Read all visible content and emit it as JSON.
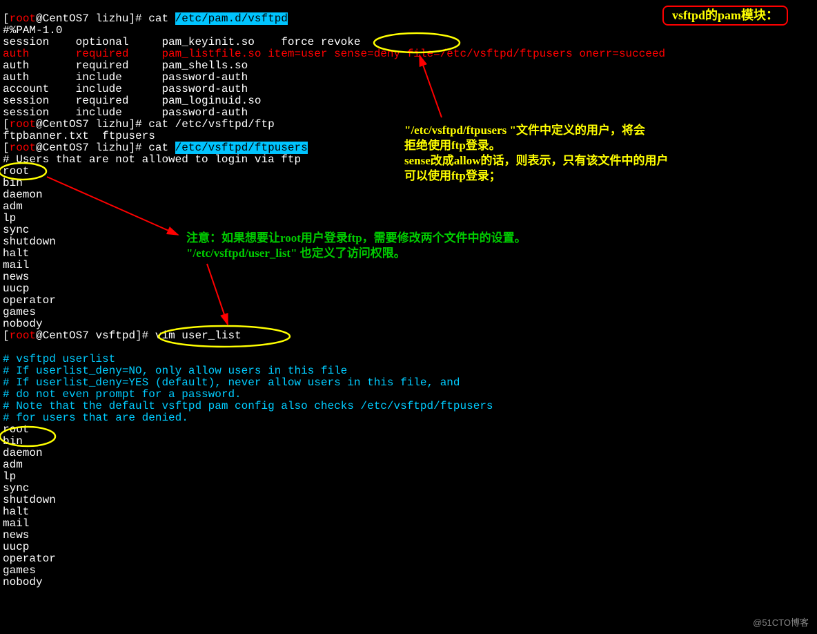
{
  "prompt": {
    "open": "[",
    "user": "root",
    "at": "@CentOS7 ",
    "dir1": "lizhu",
    "dir2": "vsftpd",
    "close": "]# "
  },
  "cmd": {
    "cat": "cat ",
    "vim": "vim "
  },
  "paths": {
    "pamd": "/etc/pam.d/vsftpd",
    "ftp": "/etc/vsftpd/ftp",
    "ftpusers": "/etc/vsftpd/ftpusers",
    "userlist": "user_list"
  },
  "pam": {
    "header": "#%PAM-1.0",
    "l1": "session    optional     pam_keyinit.so    force revoke",
    "l2a": "auth       required     pam_listfile.so item=user ",
    "l2b": "sense=deny",
    "l2c": " file=/etc/vsftpd/ftpusers onerr=succeed",
    "l3": "auth       required     pam_shells.so",
    "l4": "auth       include      password-auth",
    "l5": "account    include      password-auth",
    "l6": "session    required     pam_loginuid.so",
    "l7": "session    include      password-auth"
  },
  "ftpls": "ftpbanner.txt  ftpusers",
  "ftpusers_comment": "# Users that are not allowed to login via ftp",
  "users": [
    "root",
    "bin",
    "daemon",
    "adm",
    "lp",
    "sync",
    "shutdown",
    "halt",
    "mail",
    "news",
    "uucp",
    "operator",
    "games",
    "nobody"
  ],
  "userlist_comments": [
    "# vsftpd userlist",
    "# If userlist_deny=NO, only allow users in this file",
    "# If userlist_deny=YES (default), never allow users in this file, and",
    "# do not even prompt for a password.",
    "# Note that the default vsftpd pam config also checks /etc/vsftpd/ftpusers",
    "# for users that are denied."
  ],
  "annotations": {
    "title": "vsftpd的pam模块：",
    "note1_l1a": "\"/etc/vsftpd/ftpusers \"",
    "note1_l1b": "文件中定义的用户，将会",
    "note1_l2": "拒绝使用ftp登录。",
    "note1_l3a": "sense",
    "note1_l3b": "改成",
    "note1_l3c": "allow",
    "note1_l3d": "的话，则表示，只有该文件中的用户",
    "note1_l4": "可以使用ftp登录；",
    "note2_l1": "注意：如果想要让root用户登录ftp，需要修改两个文件中的设置。",
    "note2_l2": "\"/etc/vsftpd/user_list\" 也定义了访问权限。"
  },
  "watermark": "@51CTO博客"
}
